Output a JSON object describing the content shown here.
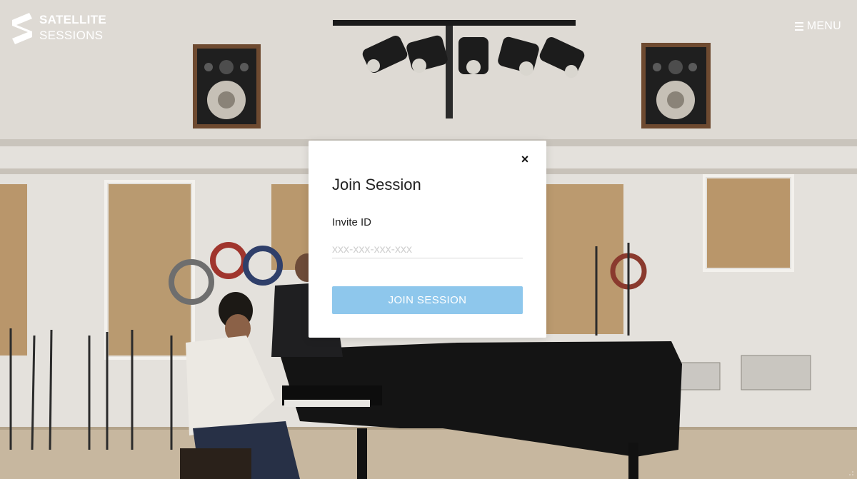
{
  "brand": {
    "line1": "SATELLITE",
    "line2": "SESSIONS"
  },
  "header": {
    "menu_label": "MENU"
  },
  "modal": {
    "title": "Join Session",
    "close_glyph": "×",
    "invite_label": "Invite ID",
    "invite_placeholder": "xxx-xxx-xxx-xxx",
    "invite_value": "",
    "submit_label": "JOIN SESSION"
  },
  "colors": {
    "accent_button": "#8ec7ec",
    "modal_bg": "#ffffff",
    "header_text": "#ffffff"
  },
  "icons": {
    "logo": "satellite-s-logo-icon",
    "menu": "hamburger-icon",
    "close": "close-icon"
  }
}
